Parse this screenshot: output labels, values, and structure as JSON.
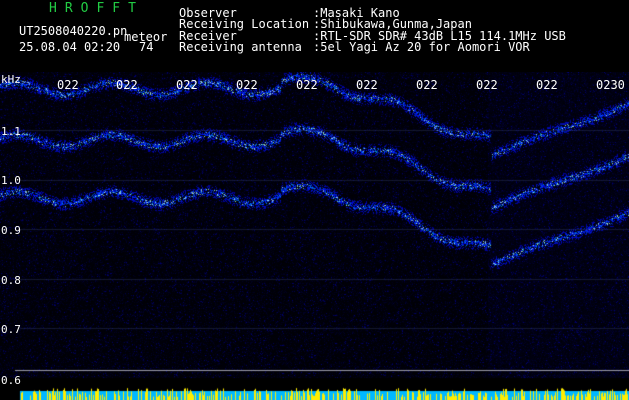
{
  "header": {
    "brand": "HROFFT",
    "filename": "UT2508040220.pn",
    "type": "meteor",
    "datetime": "25.08.04 02:20",
    "count": "74",
    "fields": [
      {
        "label": "Observer",
        "value": ":Masaki Kano"
      },
      {
        "label": "Receiving Location",
        "value": ":Shibukawa,Gunma,Japan"
      },
      {
        "label": "Receiver",
        "value": ":RTL-SDR SDR# 43dB L15 114.1MHz USB"
      },
      {
        "label": "Receiving antenna",
        "value": ":5el Yagi Az 20 for Aomori VOR"
      }
    ]
  },
  "axis": {
    "unit": "kHz",
    "freq_labels": [
      "1.1",
      "1.0",
      "0.9",
      "0.8",
      "0.7",
      "0.6"
    ],
    "time_labels": [
      "022",
      "022",
      "022",
      "022",
      "022",
      "022",
      "022",
      "022",
      "022",
      "0230"
    ]
  },
  "colors": {
    "background": "#000000",
    "brand": "#22cc44",
    "text": "#ffffff",
    "signal": "#3a6cff",
    "signal_bright": "#bfe4ff",
    "noise_bar": "#00b8ff",
    "noise_peaks": "#ffee00"
  }
}
